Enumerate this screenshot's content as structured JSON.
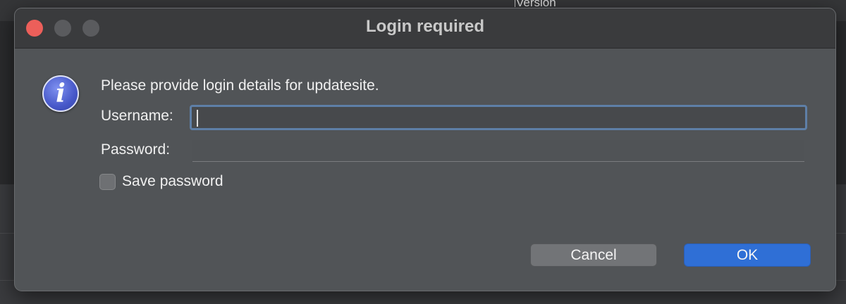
{
  "background": {
    "column_header": "Version"
  },
  "dialog": {
    "title": "Login required",
    "icon": "info-icon",
    "message": "Please provide login details for updatesite.",
    "username_label": "Username:",
    "username_value": "",
    "password_label": "Password:",
    "password_value": "",
    "save_password_label": "Save password",
    "save_password_checked": false,
    "cancel_label": "Cancel",
    "ok_label": "OK"
  },
  "colors": {
    "close_button": "#ec5f5a",
    "ok_button": "#2f6fd6",
    "focus_ring": "#5e7fa7",
    "dialog_background": "#515457"
  }
}
